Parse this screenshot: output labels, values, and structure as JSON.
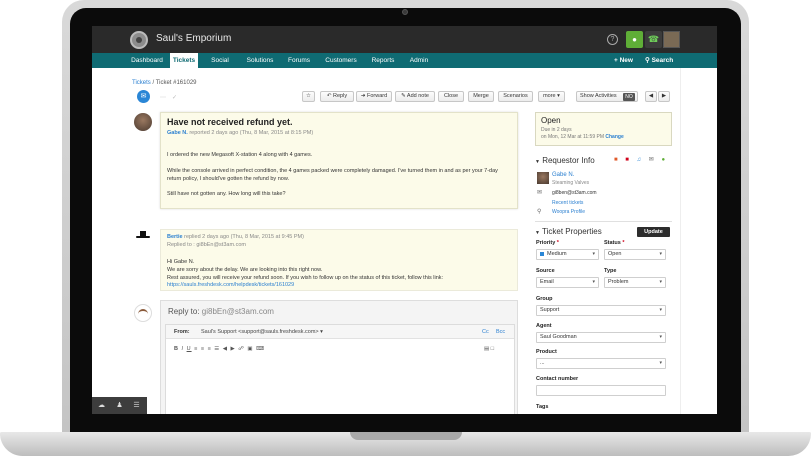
{
  "app": {
    "title": "Saul's Emporium"
  },
  "nav": {
    "items": [
      "Dashboard",
      "Tickets",
      "Social",
      "Solutions",
      "Forums",
      "Customers",
      "Reports",
      "Admin"
    ],
    "active": "Tickets",
    "new_label": "+ New",
    "search_label": "Search"
  },
  "breadcrumb": {
    "parent": "Tickets",
    "separator": " / ",
    "current": "Ticket #161029"
  },
  "toolbar": {
    "star": "☆",
    "reply": "Reply",
    "forward": "Forward",
    "add_note": "Add note",
    "close": "Close",
    "merge": "Merge",
    "scenarios": "Scenarios",
    "more": "more",
    "show_activities": "Show Activities",
    "show_activities_state": "NO"
  },
  "ticket": {
    "subject": "Have not received refund yet.",
    "customer_name": "Gabe N.",
    "customer_meta": " reported 2 days ago (Thu, 8 Mar, 2015 at 8:15 PM)",
    "body": [
      "I ordered the new Megasoft X-station 4 along with 4 games.",
      "While the console arrived in perfect condition, the 4 games packed were completely damaged. I've turned them in and as per your 7-day",
      "return policy, I should've gotten the refund by now.",
      "Still have not gotten any. How long will this take?"
    ]
  },
  "agent_reply": {
    "agent_name": "Bertie",
    "meta": " replied 2 days ago (Thu, 8 Mar, 2015 at 9:45 PM)",
    "replied_to": "Replied to : gi8bEn@st3am.com",
    "body": [
      "Hi Gabe N.",
      "We are sorry about the delay. We are looking into this right now.",
      "Rest assured, you will receive your refund soon. If you wish to follow up on the status of this ticket, follow this link:"
    ],
    "link": "https://sauls.freshdesk.com/helpdesk/tickets/161029"
  },
  "reply_box": {
    "label": "Reply to:",
    "address": " gi8bEn@st3am.com",
    "from_label": "From:",
    "from_value": "Saul's Support <support@sauls.freshdesk.com>",
    "cc": "Cc",
    "bcc": "Bcc"
  },
  "status": {
    "title": "Open",
    "due": "Due in 2 days",
    "due_date": "on Mon, 12 Mar at 11:59 PM",
    "change": "Change"
  },
  "requestor": {
    "heading": "Requestor Info",
    "name": "Gabe N.",
    "company": "Steaming Valves",
    "email": "gi8ben@st3am.com",
    "recent_tickets": "Recent tickets",
    "profile": "Woopra Profile"
  },
  "properties": {
    "heading": "Ticket Properties",
    "update": "Update",
    "priority_label": "Priority",
    "priority_value": "Medium",
    "status_label": "Status",
    "status_value": "Open",
    "source_label": "Source",
    "source_value": "Email",
    "type_label": "Type",
    "type_value": "Problem",
    "group_label": "Group",
    "group_value": "Support",
    "agent_label": "Agent",
    "agent_value": "Saul Goodman",
    "product_label": "Product",
    "product_value": "...",
    "contact_label": "Contact number",
    "tags_label": "Tags"
  },
  "colors": {
    "nav": "#0f6b73",
    "link": "#2a7fd0",
    "note_bg": "#fcfbe9"
  }
}
